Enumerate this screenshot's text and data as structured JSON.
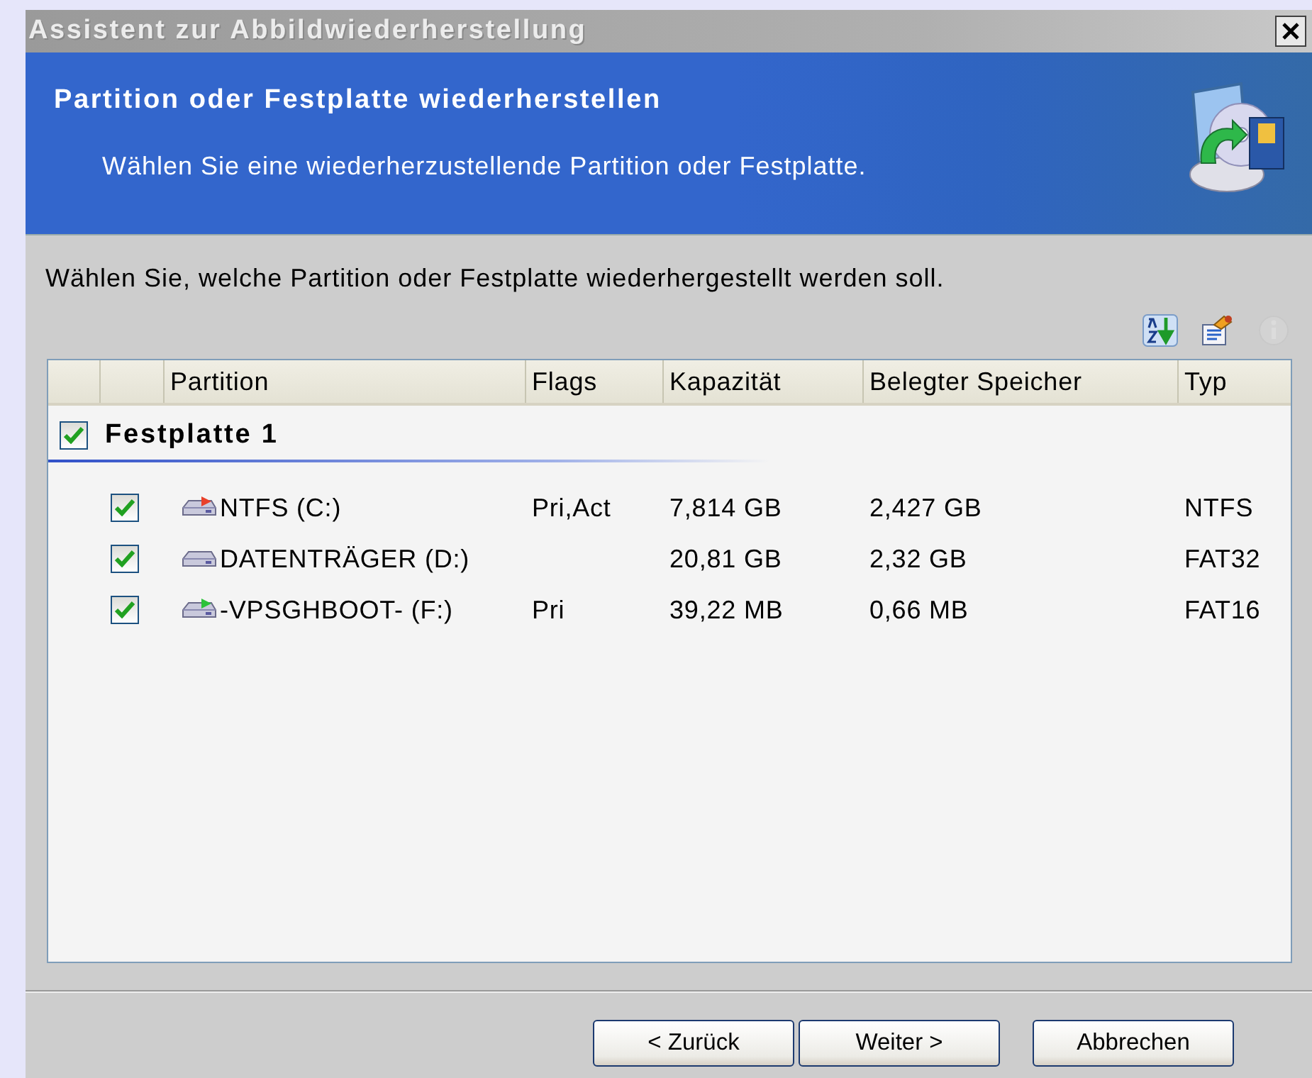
{
  "window": {
    "title": "Assistent zur Abbildwiederherstellung"
  },
  "header": {
    "title": "Partition oder Festplatte wiederherstellen",
    "subtitle": "Wählen Sie eine wiederherzustellende Partition oder Festplatte."
  },
  "instruction": "Wählen Sie, welche Partition oder Festplatte wiederhergestellt werden soll.",
  "toolbar": [
    {
      "kind": "sort",
      "disabled": false
    },
    {
      "kind": "properties",
      "disabled": false
    },
    {
      "kind": "info",
      "disabled": true
    }
  ],
  "table": {
    "columns": [
      "Partition",
      "Flags",
      "Kapazität",
      "Belegter Speicher",
      "Typ"
    ],
    "groups": [
      {
        "label": "Festplatte 1",
        "checked": true,
        "rows": [
          {
            "checked": true,
            "color": "#e8402a",
            "partition": "NTFS (C:)",
            "flags": "Pri,Act",
            "capacity": "7,814 GB",
            "used": "2,427 GB",
            "type": "NTFS"
          },
          {
            "checked": true,
            "partition": "DATENTRÄGER (D:)",
            "capacity": "20,81 GB",
            "used": "2,32 GB",
            "type": "FAT32"
          },
          {
            "checked": true,
            "color": "#2cc23a",
            "partition": "-VPSGHBOOT- (F:)",
            "flags": "Pri",
            "capacity": "39,22 MB",
            "used": "0,66 MB",
            "type": "FAT16"
          }
        ]
      }
    ]
  },
  "buttons": [
    {
      "label": "< Zurück"
    },
    {
      "label": "Weiter >"
    },
    {
      "label": "Abbrechen"
    }
  ]
}
